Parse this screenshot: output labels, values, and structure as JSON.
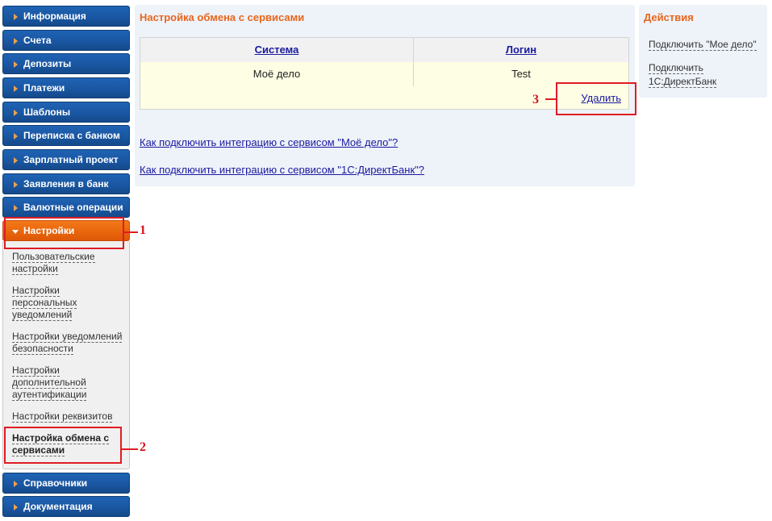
{
  "nav": {
    "items": [
      {
        "label": "Информация"
      },
      {
        "label": "Счета"
      },
      {
        "label": "Депозиты"
      },
      {
        "label": "Платежи"
      },
      {
        "label": "Шаблоны"
      },
      {
        "label": "Переписка с банком"
      },
      {
        "label": "Зарплатный проект"
      },
      {
        "label": "Заявления в банк"
      },
      {
        "label": "Валютные операции"
      },
      {
        "label": "Настройки",
        "active": true
      },
      {
        "label": "Справочники"
      },
      {
        "label": "Документация"
      }
    ],
    "settings_submenu": [
      {
        "label": "Пользовательские настройки"
      },
      {
        "label": "Настройки персональных уведомлений"
      },
      {
        "label": "Настройки уведомлений безопасности"
      },
      {
        "label": "Настройки дополнительной аутентификации"
      },
      {
        "label": "Настройки реквизитов"
      },
      {
        "label": "Настройка обмена с сервисами",
        "current": true
      }
    ]
  },
  "main": {
    "title": "Настройка обмена с сервисами",
    "table": {
      "headers": [
        "Система",
        "Логин"
      ],
      "rows": [
        [
          "Моё дело",
          "Test"
        ]
      ],
      "delete_label": "Удалить"
    },
    "help_links": [
      "Как подключить интеграцию с сервисом \"Моё дело\"?",
      "Как подключить интеграцию с сервисом \"1С:ДиректБанк\"?"
    ]
  },
  "actions": {
    "title": "Действия",
    "items": [
      "Подключить \"Мое дело\"",
      "Подключить 1С:ДиректБанк"
    ]
  },
  "annotations": {
    "step1": "1",
    "step2": "2",
    "step3": "3",
    "color": "#e01b24"
  },
  "colors": {
    "nav_blue": "#1a57a2",
    "nav_active_orange": "#e8640c",
    "title_orange": "#e8661b",
    "link_blue": "#1a1aa0",
    "table_row_bg": "#fefee4"
  }
}
